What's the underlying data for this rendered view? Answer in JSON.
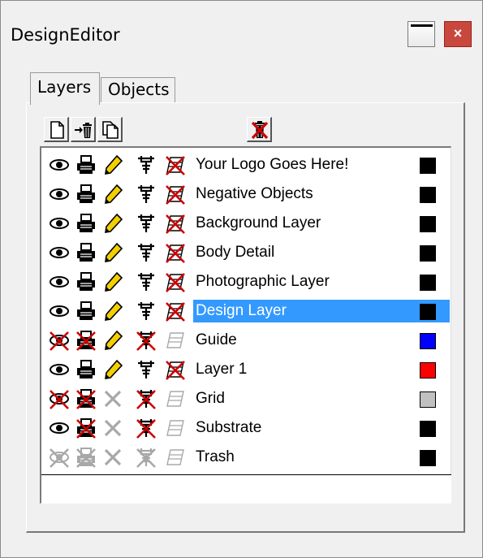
{
  "window": {
    "title": "DesignEditor",
    "close_glyph": "×"
  },
  "tabs": [
    {
      "label": "Layers",
      "active": true
    },
    {
      "label": "Objects",
      "active": false
    }
  ],
  "toolbar": {
    "buttons": [
      {
        "icon": "new-layer-icon"
      },
      {
        "icon": "move-to-trash-icon"
      },
      {
        "icon": "duplicate-layer-icon"
      },
      {
        "icon": "empty-trash-icon"
      }
    ]
  },
  "colors": {
    "selection": "#3399ff",
    "close_button": "#c8483d",
    "disabled_icon": "#a8a8a8",
    "red_x": "#cc0000"
  },
  "layers": [
    {
      "name": "Your Logo Goes Here!",
      "visible": true,
      "printable": true,
      "editable": true,
      "snap": true,
      "guide": false,
      "color": "#000000",
      "selected": false,
      "trash": false
    },
    {
      "name": "Negative Objects",
      "visible": true,
      "printable": true,
      "editable": true,
      "snap": true,
      "guide": false,
      "color": "#000000",
      "selected": false,
      "trash": false
    },
    {
      "name": "Background Layer",
      "visible": true,
      "printable": true,
      "editable": true,
      "snap": true,
      "guide": false,
      "color": "#000000",
      "selected": false,
      "trash": false
    },
    {
      "name": "Body Detail",
      "visible": true,
      "printable": true,
      "editable": true,
      "snap": true,
      "guide": false,
      "color": "#000000",
      "selected": false,
      "trash": false
    },
    {
      "name": "Photographic Layer",
      "visible": true,
      "printable": true,
      "editable": true,
      "snap": true,
      "guide": false,
      "color": "#000000",
      "selected": false,
      "trash": false
    },
    {
      "name": "Design Layer",
      "visible": true,
      "printable": true,
      "editable": true,
      "snap": true,
      "guide": false,
      "color": "#000000",
      "selected": true,
      "trash": false
    },
    {
      "name": "Guide",
      "visible": false,
      "printable": false,
      "editable": true,
      "snap": false,
      "guide": true,
      "color": "#0000ff",
      "selected": false,
      "trash": false
    },
    {
      "name": "Layer 1",
      "visible": true,
      "printable": true,
      "editable": true,
      "snap": true,
      "guide": false,
      "color": "#ff0000",
      "selected": false,
      "trash": false
    },
    {
      "name": "Grid",
      "visible": false,
      "printable": false,
      "editable": false,
      "snap": false,
      "guide": true,
      "color": "#c0c0c0",
      "selected": false,
      "trash": false
    },
    {
      "name": "Substrate",
      "visible": true,
      "printable": false,
      "editable": false,
      "snap": false,
      "guide": true,
      "color": "#000000",
      "selected": false,
      "trash": false
    },
    {
      "name": "Trash",
      "visible": false,
      "printable": false,
      "editable": false,
      "snap": false,
      "guide": true,
      "color": "#000000",
      "selected": false,
      "trash": true
    }
  ]
}
